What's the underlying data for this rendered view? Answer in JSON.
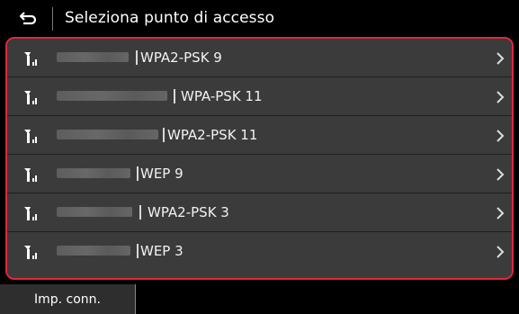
{
  "header": {
    "title": "Seleziona punto di accesso",
    "back_icon": "return-arrow-icon"
  },
  "access_points": [
    {
      "security": "WPA2-PSK 9"
    },
    {
      "security": "WPA-PSK 11"
    },
    {
      "security": "WPA2-PSK 11"
    },
    {
      "security": "WEP 9"
    },
    {
      "security": "WPA2-PSK 3"
    },
    {
      "security": "WEP 3"
    }
  ],
  "footer": {
    "connection_settings_label": "Imp. conn."
  },
  "colors": {
    "selection_border": "#e0283a",
    "row_bg": "#3b3b3b",
    "background": "#000000"
  }
}
